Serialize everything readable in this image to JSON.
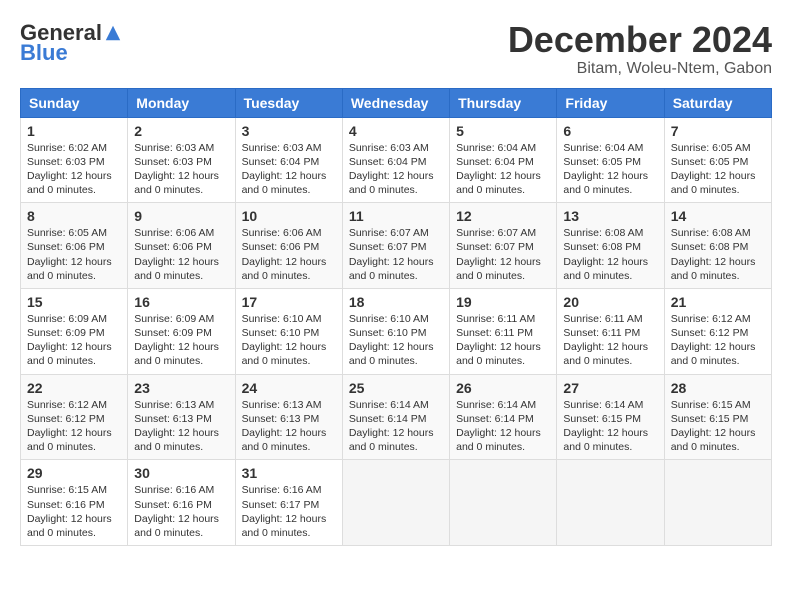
{
  "logo": {
    "general": "General",
    "blue": "Blue"
  },
  "title": {
    "month": "December 2024",
    "location": "Bitam, Woleu-Ntem, Gabon"
  },
  "headers": [
    "Sunday",
    "Monday",
    "Tuesday",
    "Wednesday",
    "Thursday",
    "Friday",
    "Saturday"
  ],
  "weeks": [
    [
      {
        "day": "1",
        "sunrise": "6:02 AM",
        "sunset": "6:03 PM",
        "daylight": "12 hours and 0 minutes."
      },
      {
        "day": "2",
        "sunrise": "6:03 AM",
        "sunset": "6:03 PM",
        "daylight": "12 hours and 0 minutes."
      },
      {
        "day": "3",
        "sunrise": "6:03 AM",
        "sunset": "6:04 PM",
        "daylight": "12 hours and 0 minutes."
      },
      {
        "day": "4",
        "sunrise": "6:03 AM",
        "sunset": "6:04 PM",
        "daylight": "12 hours and 0 minutes."
      },
      {
        "day": "5",
        "sunrise": "6:04 AM",
        "sunset": "6:04 PM",
        "daylight": "12 hours and 0 minutes."
      },
      {
        "day": "6",
        "sunrise": "6:04 AM",
        "sunset": "6:05 PM",
        "daylight": "12 hours and 0 minutes."
      },
      {
        "day": "7",
        "sunrise": "6:05 AM",
        "sunset": "6:05 PM",
        "daylight": "12 hours and 0 minutes."
      }
    ],
    [
      {
        "day": "8",
        "sunrise": "6:05 AM",
        "sunset": "6:06 PM",
        "daylight": "12 hours and 0 minutes."
      },
      {
        "day": "9",
        "sunrise": "6:06 AM",
        "sunset": "6:06 PM",
        "daylight": "12 hours and 0 minutes."
      },
      {
        "day": "10",
        "sunrise": "6:06 AM",
        "sunset": "6:06 PM",
        "daylight": "12 hours and 0 minutes."
      },
      {
        "day": "11",
        "sunrise": "6:07 AM",
        "sunset": "6:07 PM",
        "daylight": "12 hours and 0 minutes."
      },
      {
        "day": "12",
        "sunrise": "6:07 AM",
        "sunset": "6:07 PM",
        "daylight": "12 hours and 0 minutes."
      },
      {
        "day": "13",
        "sunrise": "6:08 AM",
        "sunset": "6:08 PM",
        "daylight": "12 hours and 0 minutes."
      },
      {
        "day": "14",
        "sunrise": "6:08 AM",
        "sunset": "6:08 PM",
        "daylight": "12 hours and 0 minutes."
      }
    ],
    [
      {
        "day": "15",
        "sunrise": "6:09 AM",
        "sunset": "6:09 PM",
        "daylight": "12 hours and 0 minutes."
      },
      {
        "day": "16",
        "sunrise": "6:09 AM",
        "sunset": "6:09 PM",
        "daylight": "12 hours and 0 minutes."
      },
      {
        "day": "17",
        "sunrise": "6:10 AM",
        "sunset": "6:10 PM",
        "daylight": "12 hours and 0 minutes."
      },
      {
        "day": "18",
        "sunrise": "6:10 AM",
        "sunset": "6:10 PM",
        "daylight": "12 hours and 0 minutes."
      },
      {
        "day": "19",
        "sunrise": "6:11 AM",
        "sunset": "6:11 PM",
        "daylight": "12 hours and 0 minutes."
      },
      {
        "day": "20",
        "sunrise": "6:11 AM",
        "sunset": "6:11 PM",
        "daylight": "12 hours and 0 minutes."
      },
      {
        "day": "21",
        "sunrise": "6:12 AM",
        "sunset": "6:12 PM",
        "daylight": "12 hours and 0 minutes."
      }
    ],
    [
      {
        "day": "22",
        "sunrise": "6:12 AM",
        "sunset": "6:12 PM",
        "daylight": "12 hours and 0 minutes."
      },
      {
        "day": "23",
        "sunrise": "6:13 AM",
        "sunset": "6:13 PM",
        "daylight": "12 hours and 0 minutes."
      },
      {
        "day": "24",
        "sunrise": "6:13 AM",
        "sunset": "6:13 PM",
        "daylight": "12 hours and 0 minutes."
      },
      {
        "day": "25",
        "sunrise": "6:14 AM",
        "sunset": "6:14 PM",
        "daylight": "12 hours and 0 minutes."
      },
      {
        "day": "26",
        "sunrise": "6:14 AM",
        "sunset": "6:14 PM",
        "daylight": "12 hours and 0 minutes."
      },
      {
        "day": "27",
        "sunrise": "6:14 AM",
        "sunset": "6:15 PM",
        "daylight": "12 hours and 0 minutes."
      },
      {
        "day": "28",
        "sunrise": "6:15 AM",
        "sunset": "6:15 PM",
        "daylight": "12 hours and 0 minutes."
      }
    ],
    [
      {
        "day": "29",
        "sunrise": "6:15 AM",
        "sunset": "6:16 PM",
        "daylight": "12 hours and 0 minutes."
      },
      {
        "day": "30",
        "sunrise": "6:16 AM",
        "sunset": "6:16 PM",
        "daylight": "12 hours and 0 minutes."
      },
      {
        "day": "31",
        "sunrise": "6:16 AM",
        "sunset": "6:17 PM",
        "daylight": "12 hours and 0 minutes."
      },
      null,
      null,
      null,
      null
    ]
  ],
  "labels": {
    "sunrise": "Sunrise:",
    "sunset": "Sunset:",
    "daylight": "Daylight:"
  }
}
